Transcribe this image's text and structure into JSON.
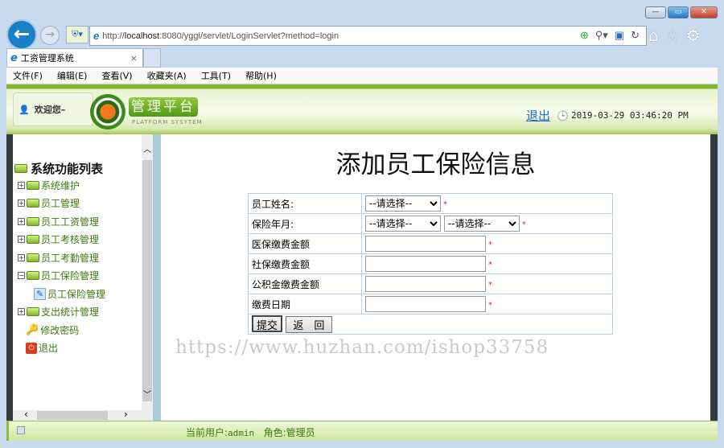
{
  "browser": {
    "url_prefix": "http://",
    "url_host": "localhost",
    "url_rest": ":8080/yggl/servlet/LoginServlet?method=login",
    "tab_title": "工资管理系统",
    "tab_close": "×",
    "menu": [
      "文件(F)",
      "编辑(E)",
      "查看(V)",
      "收藏夹(A)",
      "工具(T)",
      "帮助(H)"
    ]
  },
  "header": {
    "welcome": "欢迎您–",
    "logo_title": "管理平台",
    "logo_subtitle": "PLATFORM SYSYTEM",
    "logout": "退出",
    "datetime": "2019-03-29 03:46:20 PM"
  },
  "sidebar": {
    "title": "系统功能列表",
    "items": [
      {
        "label": "系统维护",
        "state": "+"
      },
      {
        "label": "员工管理",
        "state": "+"
      },
      {
        "label": "员工工资管理",
        "state": "+"
      },
      {
        "label": "员工考核管理",
        "state": "+"
      },
      {
        "label": "员工考勤管理",
        "state": "+"
      },
      {
        "label": "员工保险管理",
        "state": "−"
      },
      {
        "label": "员工保险管理",
        "child": true
      },
      {
        "label": "支出统计管理",
        "state": "+"
      },
      {
        "label": "修改密码"
      },
      {
        "label": "退出"
      }
    ]
  },
  "page": {
    "title": "添加员工保险信息",
    "fields": {
      "name": "员工姓名:",
      "month": "保险年月:",
      "medical": "医保缴费金额",
      "social": "社保缴费金额",
      "fund": "公积金缴费金额",
      "date": "缴费日期"
    },
    "select_placeholder": "--请选择--",
    "required": "*",
    "submit": "提交",
    "back": "返　回"
  },
  "watermark": "https://www.huzhan.com/ishop33758",
  "footer": {
    "user_label": "当前用户:",
    "user": "admin",
    "role_label": "角色:",
    "role": "管理员"
  }
}
